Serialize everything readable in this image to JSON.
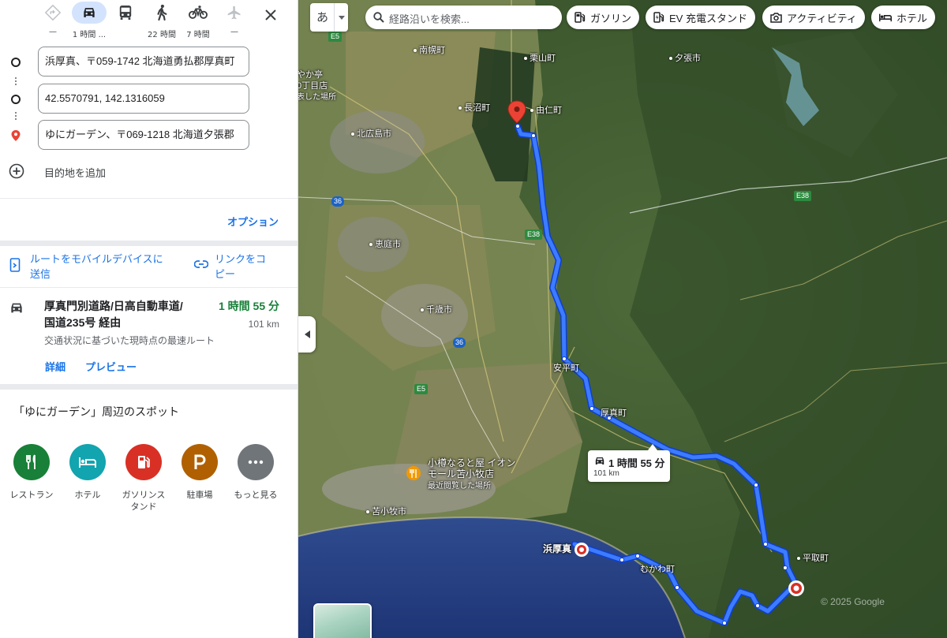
{
  "modes": [
    {
      "name": "best",
      "label": "—"
    },
    {
      "name": "drive",
      "label": "1 時間 ..."
    },
    {
      "name": "transit",
      "label": ""
    },
    {
      "name": "walk",
      "label": "22 時間"
    },
    {
      "name": "bike",
      "label": "7 時間"
    },
    {
      "name": "flight",
      "label": "—"
    }
  ],
  "waypoints": [
    {
      "value": "浜厚真、〒059-1742 北海道勇払郡厚真町"
    },
    {
      "value": "42.5570791, 142.1316059"
    },
    {
      "value": "ゆにガーデン、〒069-1218 北海道夕張郡"
    }
  ],
  "add_destination": "目的地を追加",
  "options_label": "オプション",
  "send_to_mobile": "ルートをモバイルデバイスに送信",
  "send_to_mobile_lines": [
    "ルートをモバイルデバイスに",
    "送信"
  ],
  "copy_link_lines": [
    "リンクをコ",
    "ピー"
  ],
  "route": {
    "via_lines": [
      "厚真門別道路/日高自動車道/",
      "国道235号 経由"
    ],
    "time": "1 時間 55 分",
    "distance": "101 km",
    "note": "交通状況に基づいた現時点の最速ルート",
    "details": "詳細",
    "preview": "プレビュー"
  },
  "nearby": {
    "title": "「ゆにガーデン」周辺のスポット",
    "spots": [
      {
        "label": "レストラン",
        "color": "#188038"
      },
      {
        "label": "ホテル",
        "color": "#12a4af"
      },
      {
        "label_lines": [
          "ガソリンス",
          "タンド"
        ],
        "color": "#d93025"
      },
      {
        "label": "駐車場",
        "color": "#b06000"
      },
      {
        "label": "もっと見る",
        "color": "#70757a"
      }
    ]
  },
  "map": {
    "lang_button": "あ",
    "search_placeholder": "経路沿いを検索...",
    "chips": [
      "ガソリン",
      "EV 充電スタンド",
      "アクティビティ",
      "ホテル"
    ],
    "route_bubble": {
      "time": "1 時間 55 分",
      "distance": "101 km"
    },
    "route_color": "#1a5cff",
    "places": [
      "南幌町",
      "栗山町",
      "夕張市",
      "由仁町",
      "長沼町",
      "北広島市",
      "恵庭市",
      "千歳市",
      "安平町",
      "厚真町",
      "むかわ町",
      "平取町",
      "浜厚真",
      "苫小牧市"
    ],
    "poi": {
      "title_lines": [
        "小樽なると屋 イオン",
        "モール苫小牧店"
      ],
      "subtitle": "最近閲覧した場所"
    },
    "poi2": {
      "title_lines": [
        "やか亭",
        "0丁目店"
      ],
      "subtitle": "表した場所"
    },
    "shields": [
      "E5",
      "E38",
      "E38",
      "36",
      "36",
      "E5"
    ],
    "copyright": "© 2025 Google"
  }
}
